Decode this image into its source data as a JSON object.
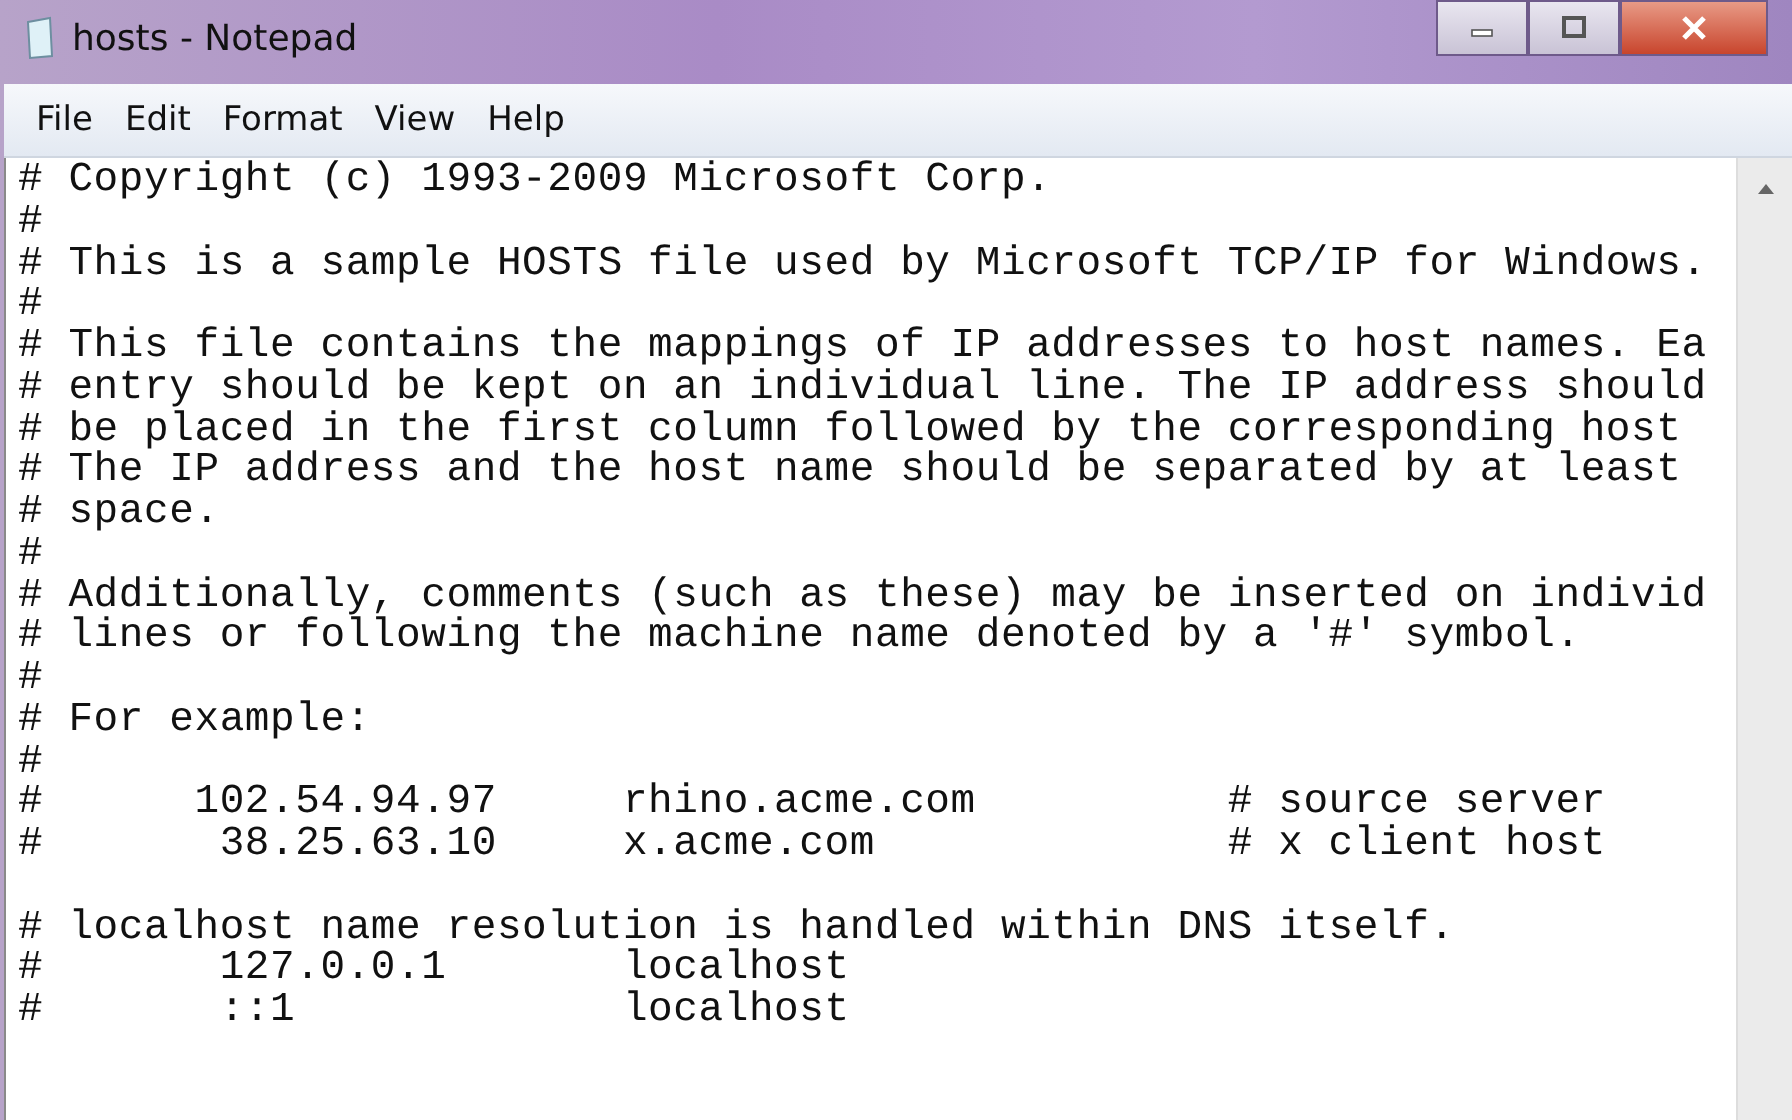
{
  "window": {
    "title": "hosts - Notepad"
  },
  "menu": [
    "File",
    "Edit",
    "Format",
    "View",
    "Help"
  ],
  "lines": [
    {
      "text": "# Copyright (c) 1993-2009 Microsoft Corp."
    },
    {
      "text": "#"
    },
    {
      "text": "# This is a sample HOSTS file used by Microsoft TCP/IP for Windows."
    },
    {
      "text": "#"
    },
    {
      "text": "# This file contains the mappings of IP addresses to host names. Ea"
    },
    {
      "text": "# entry should be kept on an individual line. The IP address should"
    },
    {
      "text": "# be placed in the first column followed by the corresponding host"
    },
    {
      "text": "# The IP address and the host name should be separated by at least"
    },
    {
      "text": "# space."
    },
    {
      "text": "#"
    },
    {
      "text": "# Additionally, comments (such as these) may be inserted on individ"
    },
    {
      "text": "# lines or following the machine name denoted by a '#' symbol."
    },
    {
      "text": "#"
    },
    {
      "text": "# For example:"
    },
    {
      "text": "#"
    },
    {
      "text": "#      102.54.94.97     rhino.acme.com          # source server"
    },
    {
      "text": "#       38.25.63.10     x.acme.com              # x client host"
    },
    {
      "text": "# localhost name resolution is handled within DNS itself.",
      "space_before": true
    },
    {
      "text": "#       127.0.0.1       localhost"
    },
    {
      "text": "#       ::1             localhost"
    }
  ]
}
